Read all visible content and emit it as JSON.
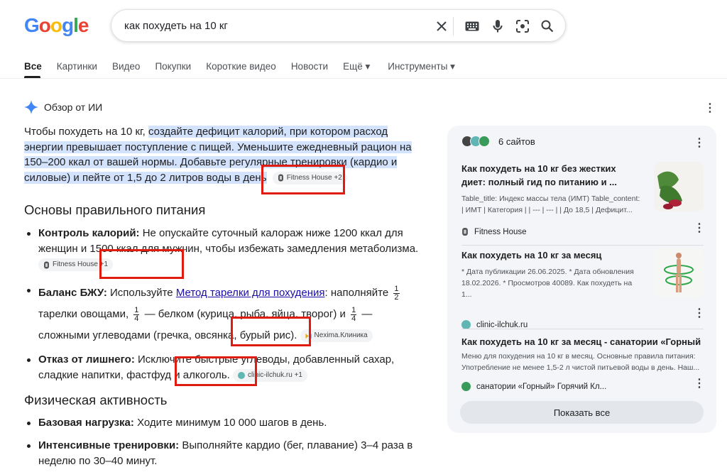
{
  "logo": [
    "G",
    "o",
    "o",
    "g",
    "l",
    "e"
  ],
  "search": {
    "query": "как похудеть на 10 кг"
  },
  "tabs": [
    "Все",
    "Картинки",
    "Видео",
    "Покупки",
    "Короткие видео",
    "Новости",
    "Ещё ▾",
    "Инструменты ▾"
  ],
  "ai_overview": {
    "label": "Обзор от ИИ",
    "intro_plain": "Чтобы похудеть на 10 кг, ",
    "intro_highlight": "создайте дефицит калорий, при котором расход энергии превышает поступление с пищей. Уменьшите ежедневный рацион на 150–200 ккал от вашей нормы. Добавьте регулярные тренировки (кардио и силовые) и пейте от 1,5 до 2 литров воды в день",
    "intro_chip": "Fitness House +2",
    "section1_title": "Основы правильного питания",
    "s1_items": [
      {
        "bold": "Контроль калорий:",
        "text": " Не опускайте суточный калораж ниже 1200 ккал для женщин и 1500 ккал для мужчин, чтобы избежать замедления метаболизма.",
        "chip": "Fitness House +1"
      },
      {
        "bold": "Баланс БЖУ:",
        "text_a": " Используйте ",
        "link": "Метод тарелки для похудения",
        "text_b": ": наполняйте ",
        "frac1_num": "1",
        "frac1_den": "2",
        "text_c": " тарелки овощами, ",
        "frac2_num": "1",
        "frac2_den": "4",
        "text_d": " — белком (курица, рыба, яйца, творог) и ",
        "frac3_num": "1",
        "frac3_den": "4",
        "text_e": " — сложными углеводами (гречка, овсянка, бурый рис).",
        "chip": "Nexima.Клиника"
      },
      {
        "bold": "Отказ от лишнего:",
        "text": " Исключите быстрые углеводы, добавленный сахар, сладкие напитки, фастфуд и алкоголь.",
        "chip": "clinic-ilchuk.ru +1"
      }
    ],
    "section2_title": "Физическая активность",
    "s2_items": [
      {
        "bold": "Базовая нагрузка:",
        "text": " Ходите минимум 10 000 шагов в день."
      },
      {
        "bold": "Интенсивные тренировки:",
        "text": " Выполняйте кардио (бег, плавание) 3–4 раза в неделю по 30–40 минут."
      }
    ]
  },
  "sources_panel": {
    "count_label": "6 сайтов",
    "cards": [
      {
        "title": "Как похудеть на 10 кг без жестких диет: полный гид по питанию и ...",
        "snippet": "Table_title: Индекс массы тела (ИМТ) Table_content: | ИМТ | Категория | | --- | --- | | До 18,5 | Дефицит...",
        "source": "Fitness House"
      },
      {
        "title": "Как похудеть на 10 кг за месяц",
        "snippet": "* Дата публикации 26.06.2025. * Дата обновления 18.02.2026. * Просмотров 40089. Как похудеть на 1...",
        "source": "clinic-ilchuk.ru"
      },
      {
        "title": "Как похудеть на 10 кг за месяц - санатории «Горный",
        "snippet": "Меню для похудения на 10 кг в месяц. Основные правила питания: Употребление не менее 1,5-2 л чистой питьевой воды в день. Наш...",
        "source": "санатории «Горный» Горячий Кл..."
      }
    ],
    "show_all": "Показать все"
  },
  "colors": {
    "highlight": "#d3e3fd",
    "annotation_red": "#e01b0f",
    "panel_bg": "#f3f5f8",
    "link": "#1a0dab"
  }
}
